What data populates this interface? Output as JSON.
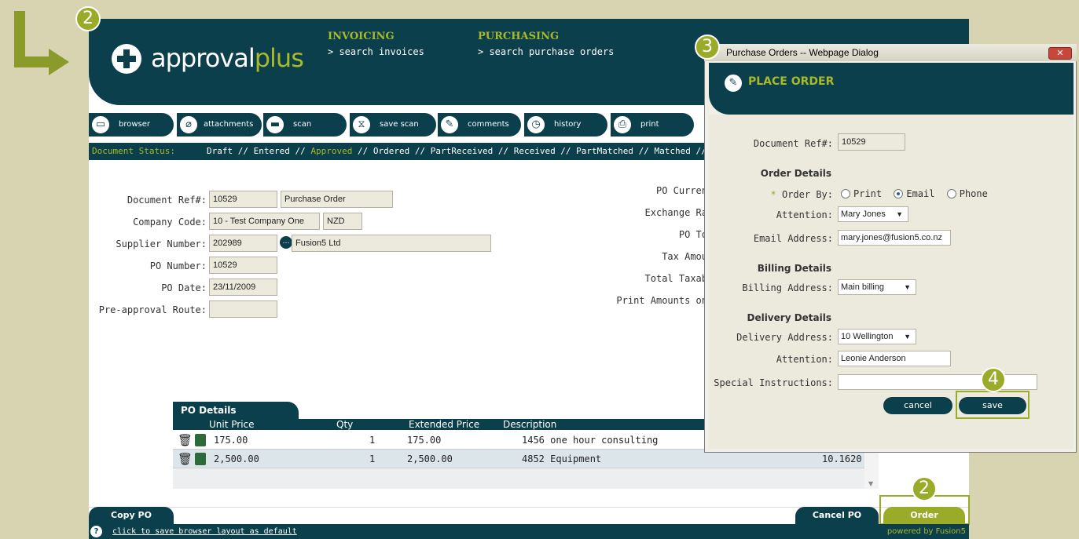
{
  "steps": {
    "step2_top": "2",
    "step2_bottom": "2",
    "step3": "3",
    "step4": "4"
  },
  "app": {
    "logo_text_a": "approval",
    "logo_text_b": "plus",
    "nav": [
      {
        "title": "INVOICING",
        "link": "> search invoices"
      },
      {
        "title": "PURCHASING",
        "link": "> search purchase orders"
      }
    ]
  },
  "toolbar": [
    {
      "label": "browser",
      "icon": "monitor-icon"
    },
    {
      "label": "attachments",
      "icon": "paperclip-icon"
    },
    {
      "label": "scan",
      "icon": "scanner-icon"
    },
    {
      "label": "save scan",
      "icon": "save-scan-icon"
    },
    {
      "label": "comments",
      "icon": "pen-icon"
    },
    {
      "label": "history",
      "icon": "clock-icon"
    },
    {
      "label": "print",
      "icon": "printer-icon"
    }
  ],
  "status": {
    "label": "Document Status:",
    "before": "Draft // Entered // ",
    "current": "Approved",
    "after": " // Ordered // PartReceived // Received // PartMatched // Matched // Canc"
  },
  "form": {
    "doc_ref_label": "Document Ref#:",
    "doc_ref": "10529",
    "doc_type": "Purchase Order",
    "company_label": "Company Code:",
    "company": "10 - Test Company One",
    "currency": "NZD",
    "supplier_label": "Supplier Number:",
    "supplier": "202989",
    "supplier_name": "Fusion5 Ltd",
    "po_number_label": "PO Number:",
    "po_number": "10529",
    "po_date_label": "PO Date:",
    "po_date": "23/11/2009",
    "route_label": "Pre-approval Route:",
    "route": "",
    "right_labels": [
      "PO Curren",
      "Exchange Ra",
      "PO To",
      "Tax Amou",
      "Total Taxab",
      "Print Amounts on"
    ]
  },
  "po_details": {
    "tab": "PO Details",
    "columns": [
      "Unit Price",
      "Qty",
      "Extended Price",
      "Description"
    ],
    "rows": [
      {
        "unit_price": "175.00",
        "qty": "1",
        "extended": "175.00",
        "description": "1456 one hour consulting",
        "extra": ""
      },
      {
        "unit_price": "2,500.00",
        "qty": "1",
        "extended": "2,500.00",
        "description": "4852 Equipment",
        "extra": "10.1620"
      }
    ]
  },
  "bottom": {
    "copy_po": "Copy PO",
    "cancel_po": "Cancel PO",
    "order": "Order"
  },
  "footer": {
    "help_link": "click to save browser layout as default",
    "powered": "powered by Fusion5"
  },
  "dialog": {
    "title": "Purchase Orders -- Webpage Dialog",
    "close": "✕",
    "heading": "PLACE ORDER",
    "doc_ref_label": "Document Ref#:",
    "doc_ref": "10529",
    "order_section": "Order Details",
    "order_by_label": "Order By:",
    "required_mark": "*",
    "order_by_options": [
      "Print",
      "Email",
      "Phone"
    ],
    "attention_label": "Attention:",
    "attention": "Mary Jones",
    "email_label": "Email Address:",
    "email": "mary.jones@fusion5.co.nz",
    "billing_section": "Billing Details",
    "billing_label": "Billing Address:",
    "billing": "Main billing",
    "delivery_section": "Delivery Details",
    "delivery_label": "Delivery Address:",
    "delivery": "10 Wellington",
    "delivery_attention_label": "Attention:",
    "delivery_attention": "Leonie Anderson",
    "instructions_label": "Special Instructions:",
    "instructions": "",
    "cancel": "cancel",
    "save": "save"
  },
  "colors": {
    "brand_dark": "#0b3f4b",
    "accent": "#a8b92a",
    "badge": "#9aab2a"
  }
}
